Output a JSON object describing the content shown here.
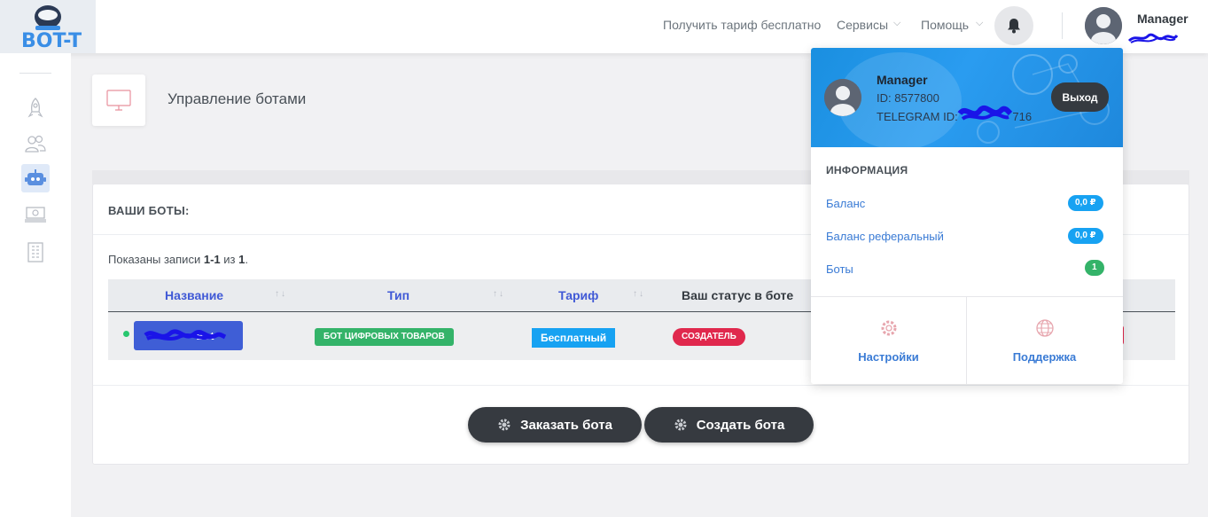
{
  "brand": {
    "logo_text": "BOT-T"
  },
  "topnav": {
    "free_tariff": "Получить тариф бесплатно",
    "services": "Сервисы",
    "help": "Помощь",
    "user_name": "Manager"
  },
  "sidebar": {
    "items": [
      "rocket-icon",
      "users-icon",
      "robot-icon",
      "money-icon",
      "building-icon"
    ]
  },
  "page": {
    "title": "Управление ботами"
  },
  "bots_card": {
    "header": "ВАШИ БОТЫ:",
    "records_prefix": "Показаны записи",
    "records_range": "1-1",
    "records_of": "из",
    "records_total": "1",
    "records_suffix": ".",
    "columns": [
      "Название",
      "Тип",
      "Тариф",
      "Ваш статус в боте"
    ],
    "rows": [
      {
        "name": "Bot",
        "type": "БОТ ЦИФРОВЫХ ТОВАРОВ",
        "tariff": "Бесплатный",
        "status": "СОЗДАТЕЛЬ"
      }
    ],
    "order_bot": "Заказать бота",
    "create_bot": "Создать бота"
  },
  "user_menu": {
    "name": "Manager",
    "id_line": "ID: 8577800",
    "telegram_prefix": "TELEGRAM ID:",
    "telegram_suffix": "716",
    "logout": "Выход",
    "section": "ИНФОРМАЦИЯ",
    "items": [
      {
        "label": "Баланс",
        "value": "0,0 ₽",
        "color": "#17a2f2"
      },
      {
        "label": "Баланс реферальный",
        "value": "0,0 ₽",
        "color": "#17a2f2"
      },
      {
        "label": "Боты",
        "value": "1",
        "color": "#34b369"
      }
    ],
    "settings": "Настройки",
    "support": "Поддержка"
  },
  "colors": {
    "accent": "#3f5ed6",
    "dark_button": "#363a40",
    "success": "#34b369",
    "danger": "#e0284d",
    "info": "#17a2f2"
  }
}
